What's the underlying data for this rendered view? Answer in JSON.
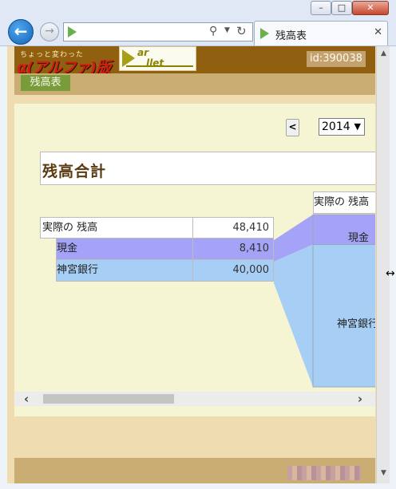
{
  "browser": {
    "window_controls": {
      "minimize": "–",
      "maximize": "□",
      "close": "✕"
    },
    "tab": {
      "title": "残高表",
      "close": "✕"
    }
  },
  "site": {
    "logo_alpha_small": "ちょっと変わった",
    "logo_alpha_big": "α(アルファ)版",
    "logo_parllet_line1": "ar",
    "logo_parllet_line2": "llet",
    "user_id": "id:390038",
    "nav_button": "残高表"
  },
  "controls": {
    "prev_label": "<",
    "year": "2014",
    "year_options": [
      "2014"
    ]
  },
  "summary": {
    "title": "残高合計",
    "rows": [
      {
        "name": "実際の 残高",
        "amount": "48,410"
      },
      {
        "name": "現金",
        "amount": "8,410"
      },
      {
        "name": "神宮銀行",
        "amount": "40,000"
      }
    ]
  },
  "chart_data": {
    "type": "bar",
    "title": "",
    "categories": [
      "実際の 残高"
    ],
    "series": [
      {
        "name": "現金",
        "values": [
          8410
        ]
      },
      {
        "name": "神宮銀行",
        "values": [
          40000
        ]
      }
    ],
    "header": "実際の 残高",
    "labels": [
      "現金",
      "神宮銀行"
    ],
    "colors": {
      "現金": "#a5a3f8",
      "神宮銀行": "#a7cff6"
    }
  },
  "colors": {
    "page_bg": "#efddb1",
    "header_brown": "#915f10",
    "nav_green": "#7a9b3a",
    "panel_bg": "#f6f5d3"
  }
}
